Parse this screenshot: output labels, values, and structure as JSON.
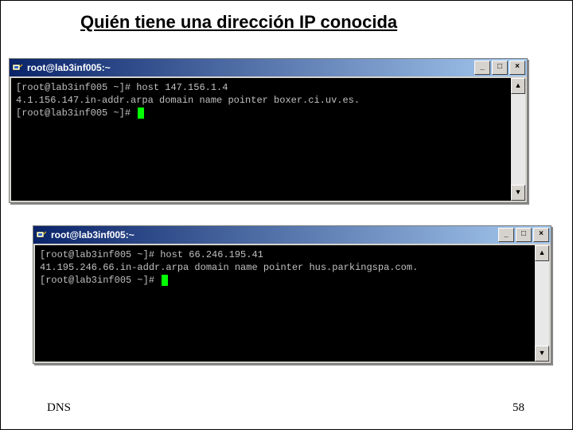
{
  "title": "Quién tiene una dirección IP conocida",
  "footer_left": "DNS",
  "footer_right": "58",
  "win_controls": {
    "min": "_",
    "max": "□",
    "close": "×"
  },
  "term1": {
    "window_title": "root@lab3inf005:~",
    "lines": {
      "l0_prompt": "[root@lab3inf005 ~]#",
      "l0_cmd": " host 147.156.1.4",
      "l1": "4.1.156.147.in-addr.arpa domain name pointer boxer.ci.uv.es.",
      "l2_prompt": "[root@lab3inf005 ~]#"
    }
  },
  "term2": {
    "window_title": "root@lab3inf005:~",
    "lines": {
      "l0_prompt": "[root@lab3inf005 ~]#",
      "l0_cmd": " host 66.246.195.41",
      "l1": "41.195.246.66.in-addr.arpa domain name pointer hus.parkingspa.com.",
      "l2_prompt": "[root@lab3inf005 ~]#"
    }
  }
}
